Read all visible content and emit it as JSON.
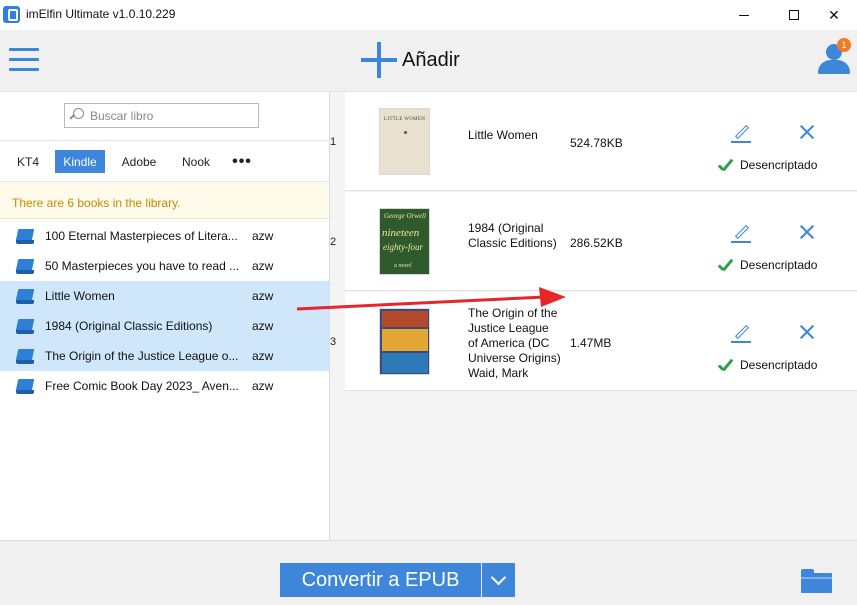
{
  "window": {
    "title": "imElfin Ultimate v1.0.10.229",
    "minimize": "",
    "maximize": "",
    "close": "✕"
  },
  "toolbar": {
    "add_label": "Añadir",
    "notification_count": "1"
  },
  "library": {
    "search_placeholder": "Buscar libro",
    "tabs": [
      {
        "label": "KT4",
        "active": false
      },
      {
        "label": "Kindle",
        "active": true
      },
      {
        "label": "Adobe",
        "active": false
      },
      {
        "label": "Nook",
        "active": false
      },
      {
        "label": "•••",
        "active": false
      }
    ],
    "info": "There are 6 books in the library.",
    "books": [
      {
        "title": "100 Eternal Masterpieces of Litera...",
        "format": "azw",
        "selected": false
      },
      {
        "title": "50 Masterpieces you have to read ...",
        "format": "azw",
        "selected": false
      },
      {
        "title": "Little Women",
        "format": "azw",
        "selected": true
      },
      {
        "title": "1984 (Original Classic Editions)",
        "format": "azw",
        "selected": true
      },
      {
        "title": "The Origin of the Justice League o...",
        "format": "azw",
        "selected": true
      },
      {
        "title": "Free Comic Book Day 2023_ Aven...",
        "format": "azw",
        "selected": false
      }
    ]
  },
  "queue": [
    {
      "index": "1",
      "title_lines": [
        "Little Women"
      ],
      "size": "524.78KB",
      "status": "Desencriptado",
      "cover_text": "LITTLE WOMEN"
    },
    {
      "index": "2",
      "title_lines": [
        "1984 (Original",
        "Classic Editions)"
      ],
      "size": "286.52KB",
      "status": "Desencriptado",
      "cover_text": [
        "George Orwell",
        "nineteen",
        "eighty-four",
        "a novel"
      ]
    },
    {
      "index": "3",
      "title_lines": [
        "The Origin of the",
        "Justice League",
        "of America (DC",
        "Universe Origins)",
        "Waid, Mark"
      ],
      "size": "1.47MB",
      "status": "Desencriptado"
    }
  ],
  "bottom": {
    "convert_label": "Convertir a EPUB"
  },
  "colors": {
    "accent": "#3d86d9",
    "success": "#2aa14a",
    "info_text": "#c78a00",
    "selection": "#cfe6fb",
    "annotation_arrow": "#e5262b"
  }
}
